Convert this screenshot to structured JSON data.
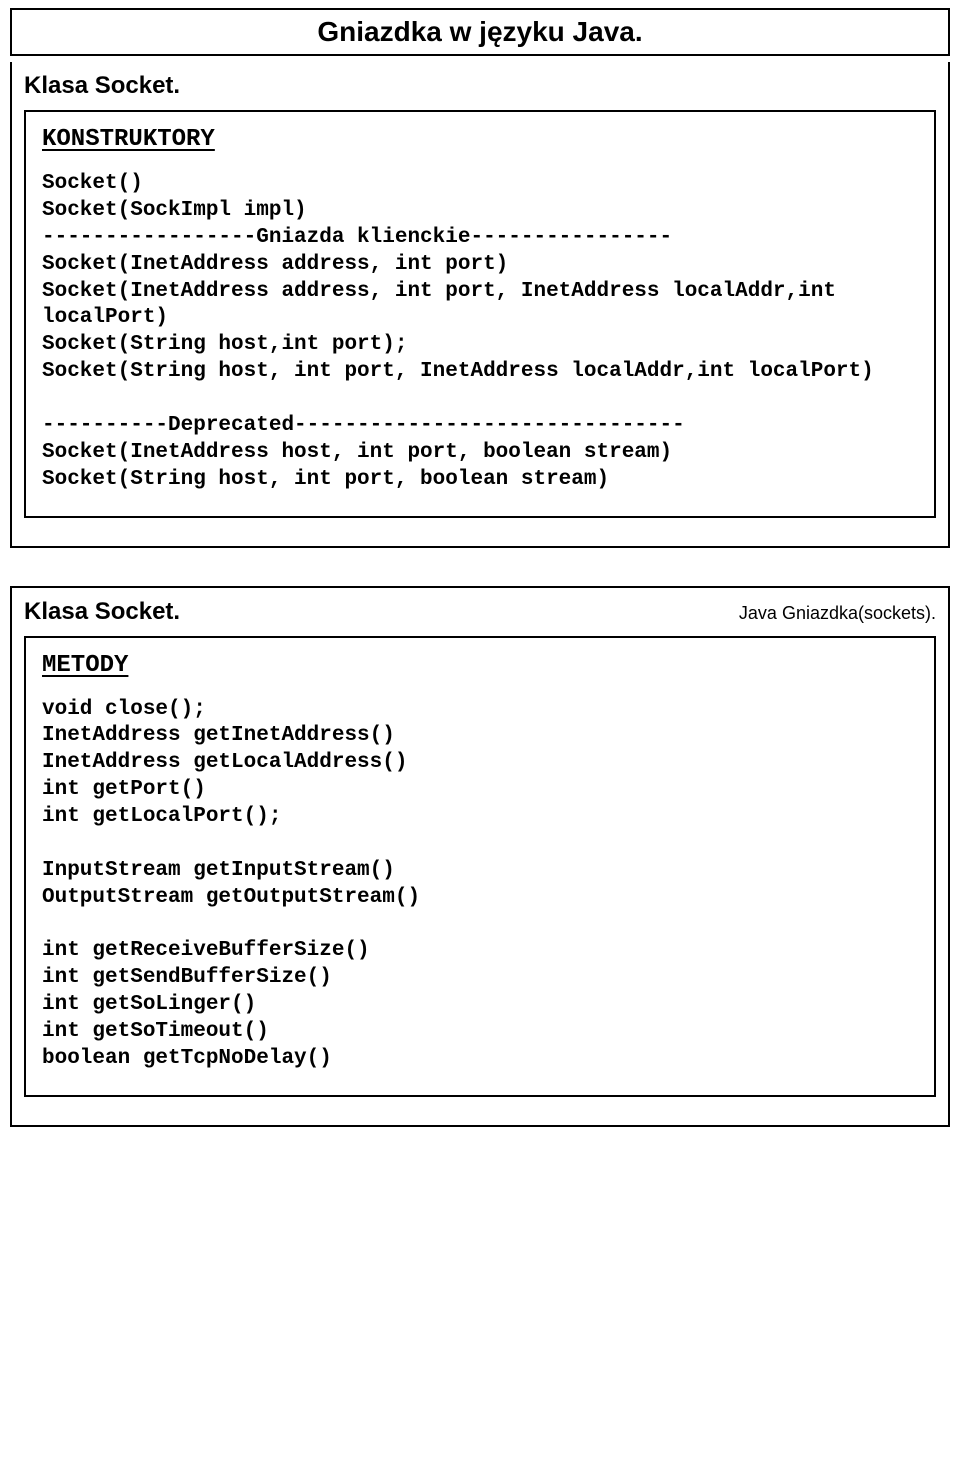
{
  "slide1": {
    "title": "Gniazdka w języku Java.",
    "section_label": "Klasa Socket.",
    "subheading": "KONSTRUKTORY",
    "code": "Socket()\nSocket(SockImpl impl)\n-----------------Gniazda klienckie----------------\nSocket(InetAddress address, int port)\nSocket(InetAddress address, int port, InetAddress localAddr,int localPort)\nSocket(String host,int port);\nSocket(String host, int port, InetAddress localAddr,int localPort)\n\n----------Deprecated-------------------------------\nSocket(InetAddress host, int port, boolean stream)\nSocket(String host, int port, boolean stream)"
  },
  "slide2": {
    "section_label": "Klasa Socket.",
    "section_note": "Java Gniazdka(sockets).",
    "subheading": "METODY",
    "code": "void close();\nInetAddress getInetAddress()\nInetAddress getLocalAddress()\nint getPort()\nint getLocalPort();\n\nInputStream getInputStream()\nOutputStream getOutputStream()\n\nint getReceiveBufferSize()\nint getSendBufferSize()\nint getSoLinger()\nint getSoTimeout()\nboolean getTcpNoDelay()"
  }
}
